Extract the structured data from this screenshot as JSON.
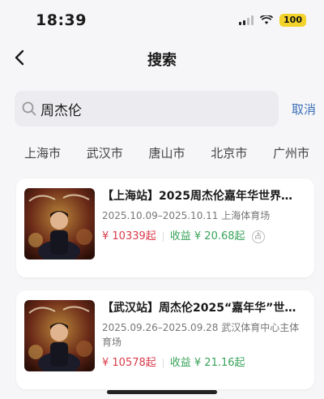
{
  "status_bar": {
    "time": "18:39",
    "battery": "100",
    "icons": [
      "signal-icon",
      "wifi-icon",
      "battery-icon"
    ]
  },
  "nav": {
    "title": "搜索"
  },
  "search": {
    "value": "周杰伦",
    "cancel_label": "取消"
  },
  "cities": [
    "上海市",
    "武汉市",
    "唐山市",
    "北京市",
    "广州市"
  ],
  "results": [
    {
      "title": "【上海站】2025周杰伦嘉年华世界…",
      "date": "2025.10.09–2025.10.11",
      "venue": "上海体育场",
      "price": "¥ 10339起",
      "gain": "收益 ¥ 20.68起",
      "tag": "占"
    },
    {
      "title": "【武汉站】周杰伦2025“嘉年华”世…",
      "date": "2025.09.26–2025.09.28",
      "venue": "武汉体育中心主体育场",
      "price": "¥ 10578起",
      "gain": "收益 ¥ 21.16起"
    }
  ],
  "colors": {
    "price": "#d93a4a",
    "gain": "#3aa35a",
    "link": "#3a6fb5",
    "battery": "#f3d32a"
  }
}
